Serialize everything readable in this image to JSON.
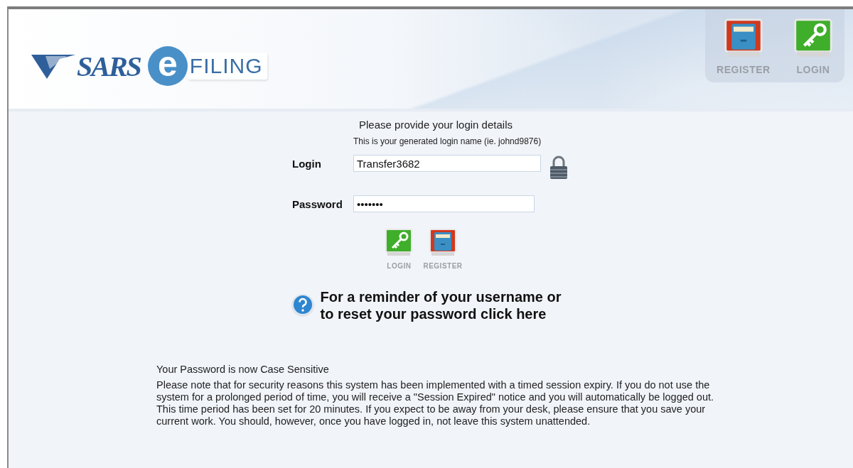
{
  "logo": {
    "brand": "SARS",
    "e_mark": "e",
    "product": "FILING"
  },
  "header_nav": [
    {
      "kind": "register",
      "label": "REGISTER"
    },
    {
      "kind": "login",
      "label": "LOGIN"
    }
  ],
  "login_form": {
    "title": "Please provide your login details",
    "login_hint": "This is your generated login name (ie. johnd9876)",
    "fields": [
      {
        "kind": "login",
        "label": "Login",
        "value": "Transfer3682"
      },
      {
        "kind": "password",
        "label": "Password",
        "value": "•••••••"
      }
    ],
    "buttons": [
      {
        "kind": "login",
        "label": "LOGIN"
      },
      {
        "kind": "register",
        "label": "REGISTER"
      }
    ]
  },
  "help_link": {
    "line_1": "For a reminder of your username or",
    "line_2": "to reset your password click here"
  },
  "notice": {
    "heading": "Your Password is now Case Sensitive",
    "body": "Please note that for security reasons this system has been implemented with a timed session expiry. If you do not use the system for a prolonged period of time, you will receive a \"Session Expired\" notice and you will automatically be logged out. This time period has been set for 20 minutes. If you expect to be away from your desk, please ensure that you save your current work. You should, however, once you have logged in, not leave this system unattended."
  }
}
